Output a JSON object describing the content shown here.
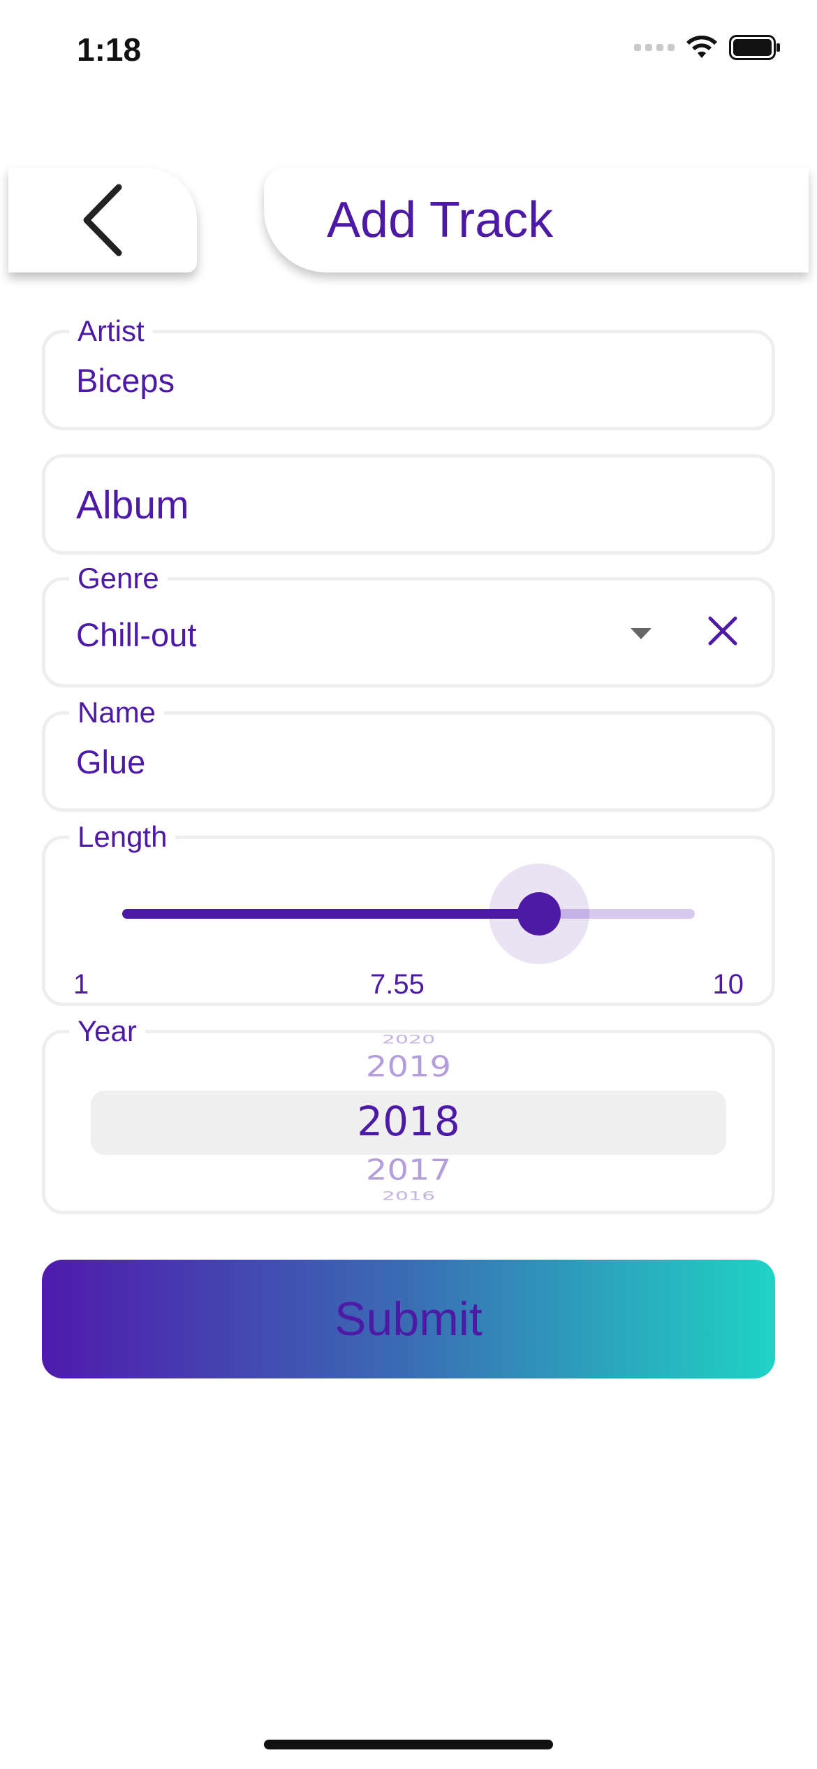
{
  "status_bar": {
    "time": "1:18",
    "icons": [
      "signal-icon",
      "wifi-icon",
      "battery-icon"
    ]
  },
  "header": {
    "back_icon": "chevron-left-icon",
    "title": "Add Track"
  },
  "form": {
    "artist": {
      "label": "Artist",
      "value": "Biceps"
    },
    "album": {
      "placeholder": "Album"
    },
    "genre": {
      "label": "Genre",
      "value": "Chill-out",
      "dropdown_icon": "caret-down-icon",
      "clear_icon": "close-icon"
    },
    "name": {
      "label": "Name",
      "value": "Glue"
    },
    "length": {
      "label": "Length",
      "min": "1",
      "value": "7.55",
      "max": "10",
      "fraction": 0.728
    },
    "year": {
      "label": "Year",
      "options": [
        "2020",
        "2019",
        "2018",
        "2017",
        "2016"
      ],
      "selected": "2018"
    }
  },
  "submit": {
    "label": "Submit"
  },
  "colors": {
    "accent": "#4d1aa6",
    "gradient_start": "#4f1aad",
    "gradient_end": "#1fd3c4",
    "field_border": "#eeeeee"
  }
}
